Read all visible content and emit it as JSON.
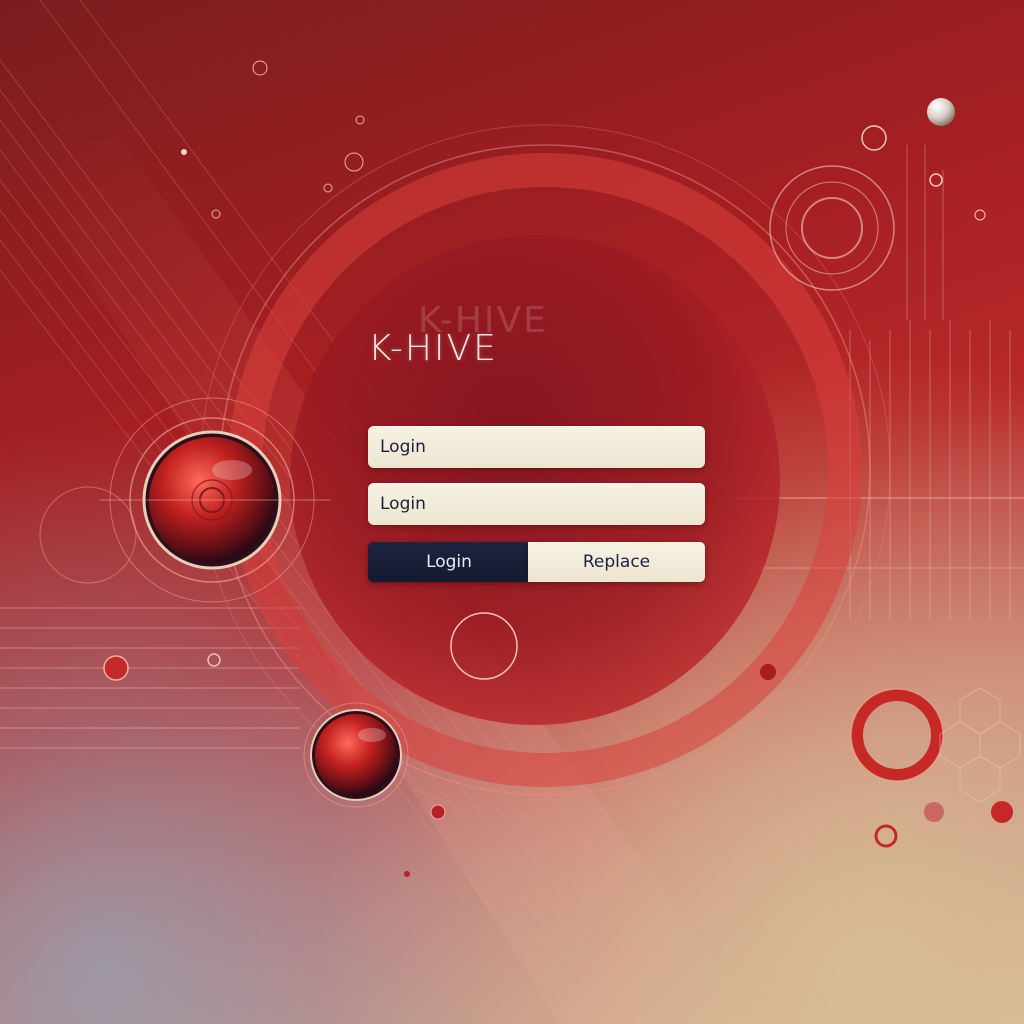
{
  "app": {
    "title": "K-HIVE"
  },
  "form": {
    "field1_value": "Login",
    "field2_value": "Login",
    "login_button_label": "Login",
    "replace_button_label": "Replace"
  },
  "colors": {
    "background_primary": "#a51f22",
    "field_background": "#f2ecd8",
    "login_button_background": "#1a2038",
    "accent_orb": "#c62828"
  },
  "icons": {
    "large_orb": "red-orb-icon",
    "small_orb": "red-orb-icon",
    "circle_target": "target-ring-icon"
  }
}
